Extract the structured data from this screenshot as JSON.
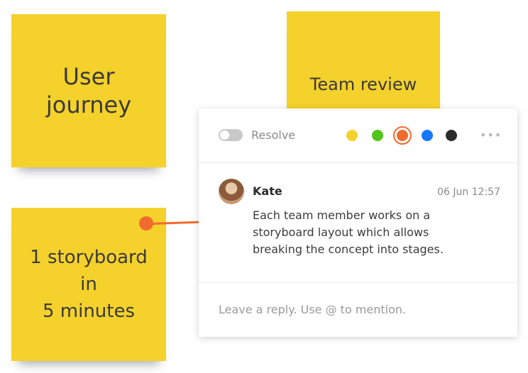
{
  "stickies": {
    "user_journey": "User\njourney",
    "storyboard": "1 storyboard\nin\n5 minutes",
    "team_review": "Team review"
  },
  "colors": {
    "sticky": "#f5d12b",
    "connector": "#f26b2e",
    "swatches": [
      "#f5d12b",
      "#52c41a",
      "#f26b2e",
      "#1677ff",
      "#2b2b2b"
    ],
    "selected_swatch": "#f26b2e"
  },
  "card": {
    "resolve_label": "Resolve",
    "more_icon": "•••",
    "comment": {
      "author": "Kate",
      "timestamp": "06 Jun 12:57",
      "text": "Each team member works on a storyboard layout which allows breaking the concept into stages."
    },
    "reply_placeholder": "Leave a reply. Use @ to mention."
  }
}
